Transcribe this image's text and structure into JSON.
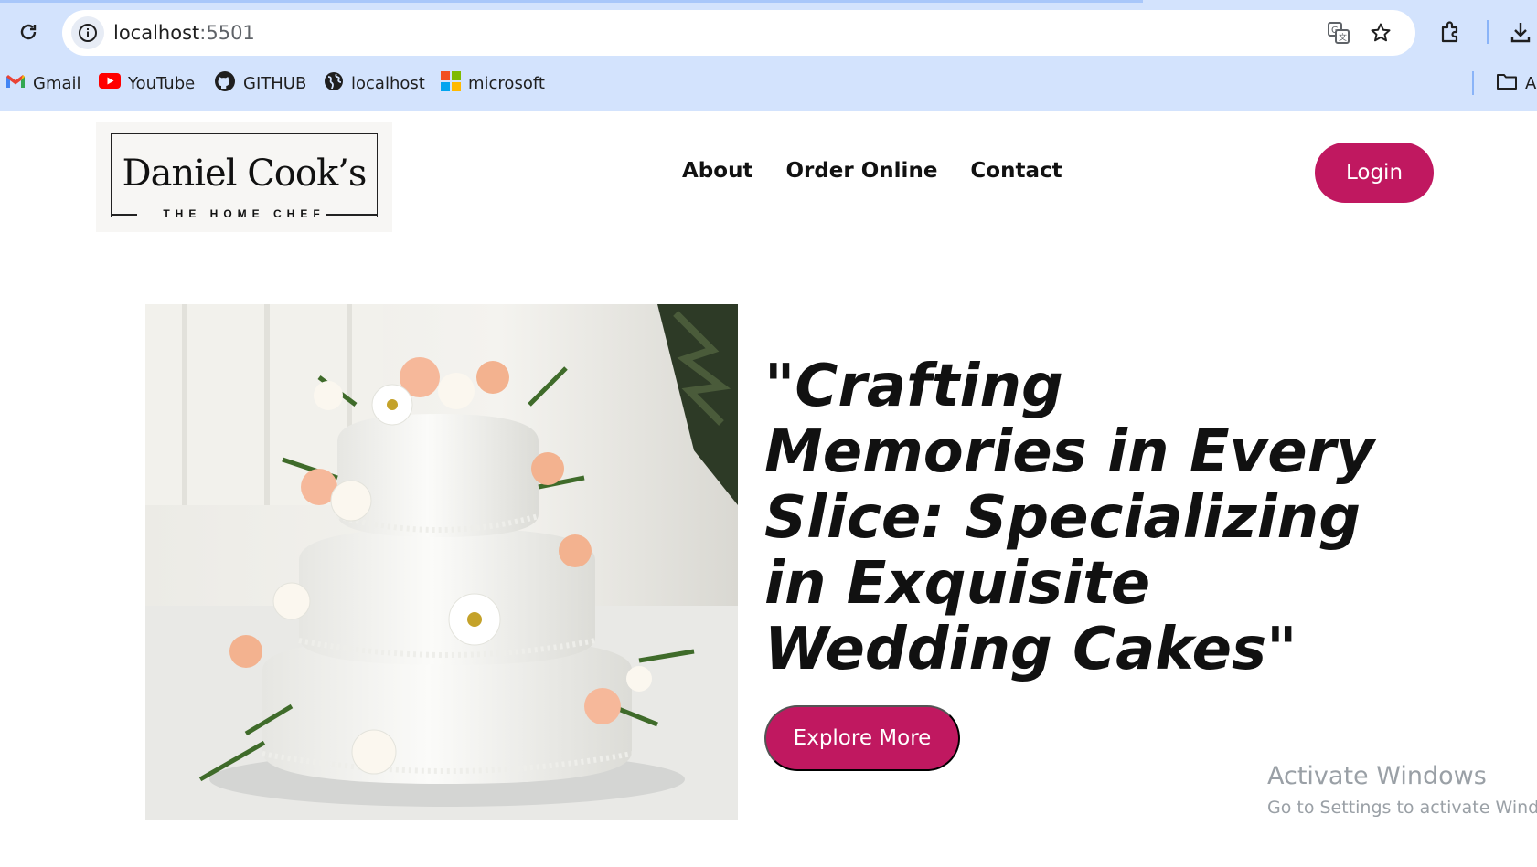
{
  "browser": {
    "url_host": "localhost",
    "url_port": ":5501",
    "bookmarks": [
      {
        "label": "Gmail",
        "icon": "gmail-icon"
      },
      {
        "label": "YouTube",
        "icon": "youtube-icon"
      },
      {
        "label": "GITHUB",
        "icon": "github-icon"
      },
      {
        "label": "localhost",
        "icon": "globe-icon"
      },
      {
        "label": "microsoft",
        "icon": "microsoft-icon"
      }
    ],
    "bookmark_partial": "A",
    "accent": "#d3e3fd"
  },
  "header": {
    "logo_name": "Daniel Cook’s",
    "logo_tagline": "THE HOME CHEF",
    "nav": [
      "About",
      "Order Online",
      "Contact"
    ],
    "login_label": "Login"
  },
  "hero": {
    "headline": "\"Crafting Memories in Every Slice: Specializing in Exquisite Wedding Cakes\"",
    "cta_label": "Explore More",
    "image": "three-tier-wedding-cake-with-flowers"
  },
  "watermark": {
    "title": "Activate Windows",
    "subtitle": "Go to Settings to activate Windows."
  },
  "colors": {
    "brand": "#c01860",
    "text": "#111111",
    "watermark": "#9aa0a6"
  }
}
